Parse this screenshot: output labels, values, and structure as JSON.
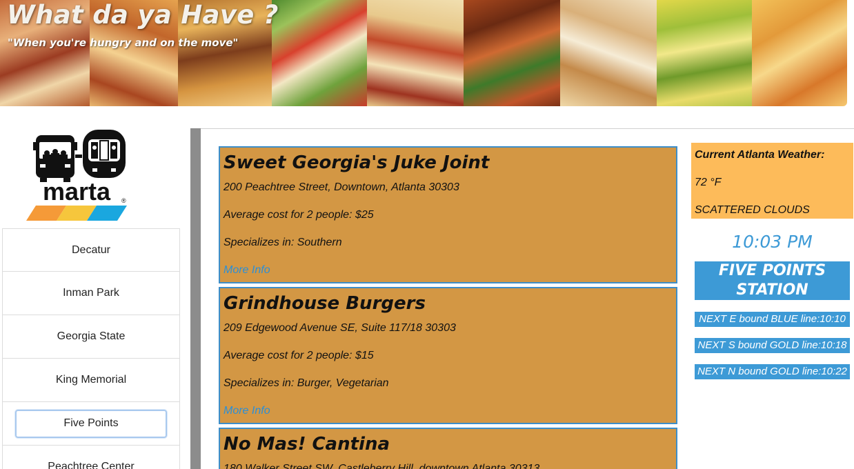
{
  "header": {
    "title": "What da ya Have ?",
    "subtitle": "\"When you're hungry and on the move\""
  },
  "logo": {
    "text": "marta",
    "registered": "®"
  },
  "stations": [
    {
      "label": "Decatur",
      "active": false
    },
    {
      "label": "Inman Park",
      "active": false
    },
    {
      "label": "Georgia State",
      "active": false
    },
    {
      "label": "King Memorial",
      "active": false
    },
    {
      "label": "Five Points",
      "active": true
    },
    {
      "label": "Peachtree Center",
      "active": false
    }
  ],
  "restaurants": [
    {
      "name": "Sweet Georgia's Juke Joint",
      "address": "200 Peachtree Street, Downtown, Atlanta 30303",
      "cost": "Average cost for 2 people: $25",
      "specialty": "Specializes in: Southern",
      "link": "More Info"
    },
    {
      "name": "Grindhouse Burgers",
      "address": "209 Edgewood Avenue SE, Suite 117/18 30303",
      "cost": "Average cost for 2 people: $15",
      "specialty": "Specializes in: Burger, Vegetarian",
      "link": "More Info"
    },
    {
      "name": "No Mas! Cantina",
      "address": "180 Walker Street SW, Castleberry Hill, downtown Atlanta 30313"
    }
  ],
  "weather": {
    "title": "Current Atlanta Weather:",
    "temp": "72 °F",
    "condition": "SCATTERED CLOUDS"
  },
  "clock": "10:03 PM",
  "station_banner": "FIVE POINTS STATION",
  "trains": [
    "NEXT E bound BLUE line:10:10",
    "NEXT S bound GOLD line:10:18",
    "NEXT N bound GOLD line:10:22"
  ],
  "colors": {
    "card_bg": "#d39744",
    "card_border": "#3d8ec9",
    "weather_bg": "#fdbb5a",
    "accent_blue": "#3d9ad6",
    "link": "#2a8fd8",
    "logo_orange": "#f59a38",
    "logo_yellow": "#f6c63c",
    "logo_blue": "#1aa7df"
  }
}
